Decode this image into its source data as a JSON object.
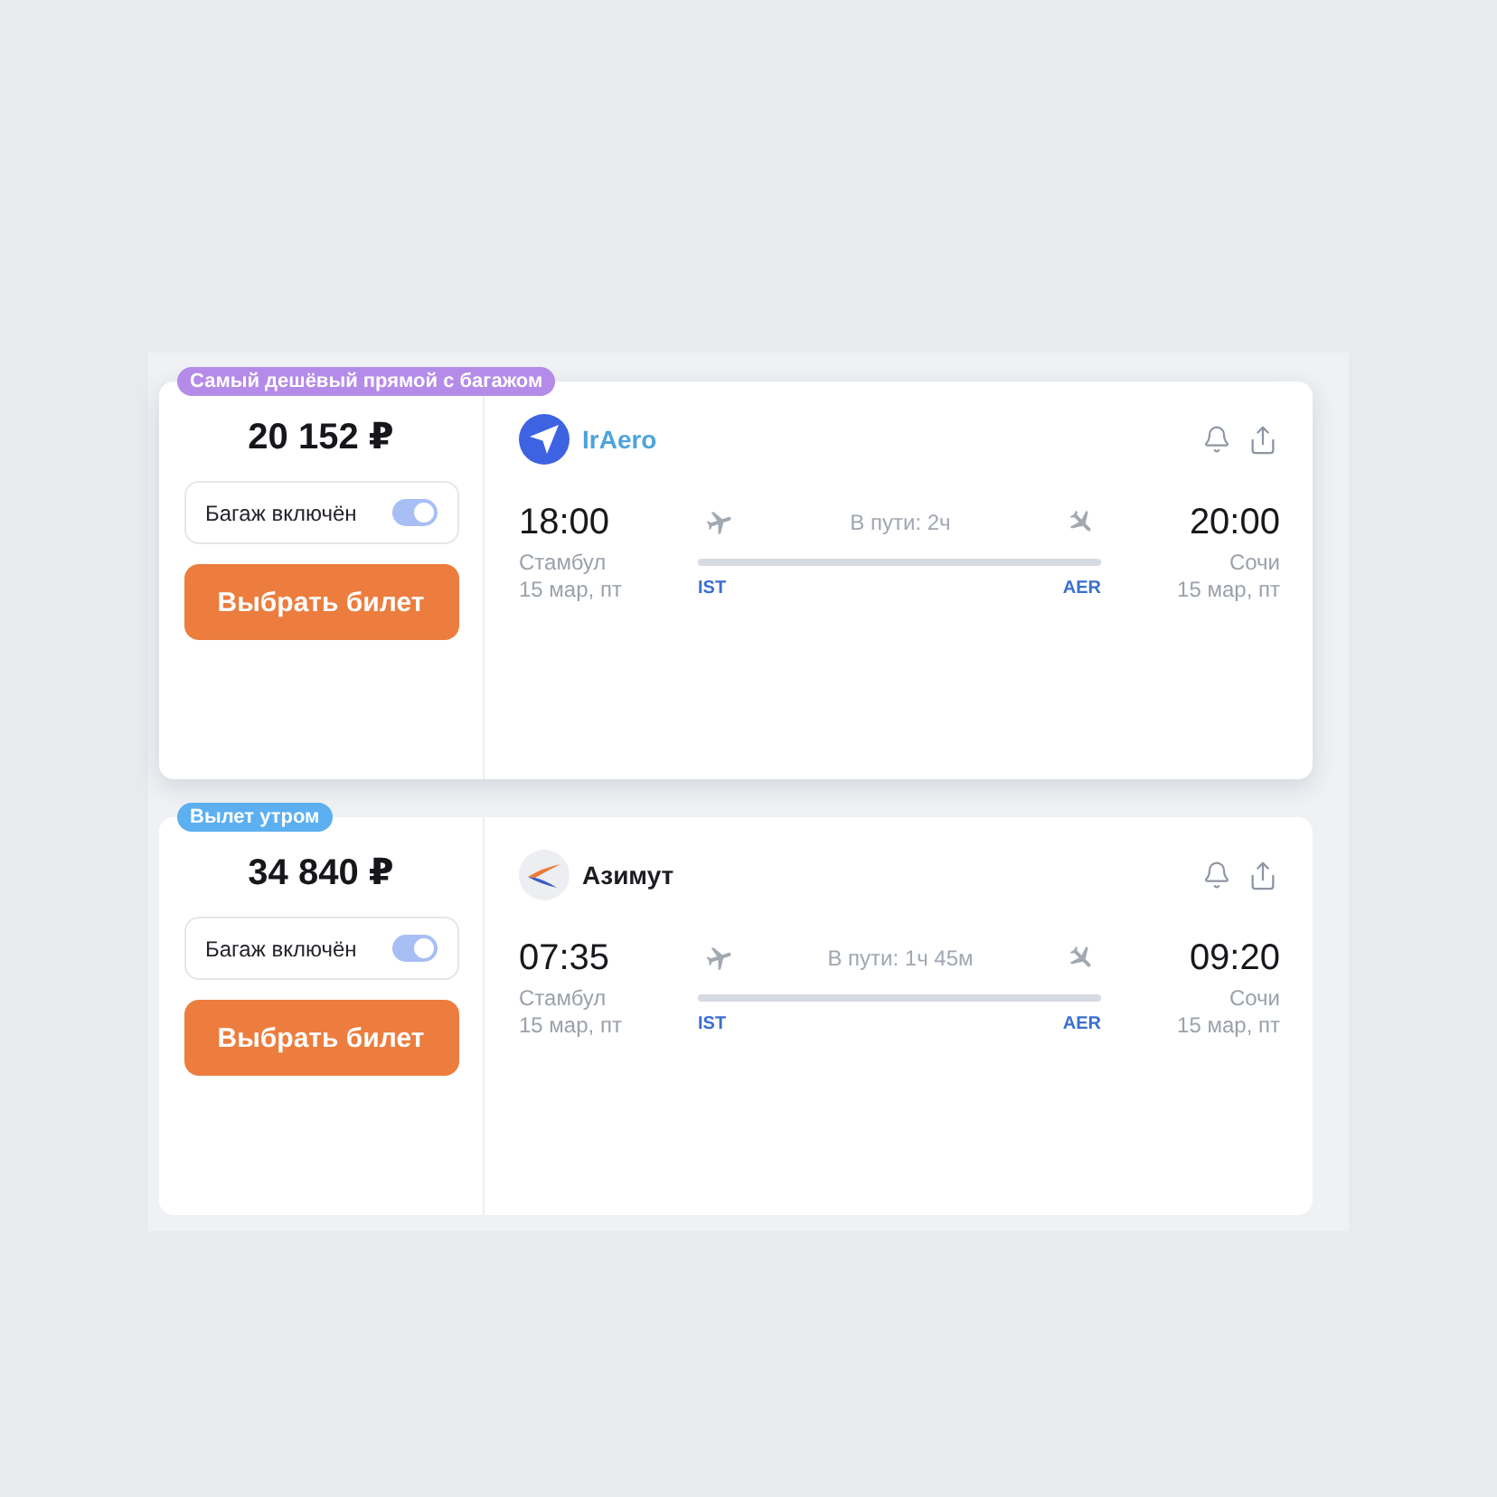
{
  "flights": [
    {
      "raised": true,
      "badge": {
        "text": "Самый дешёвый прямой с багажом",
        "color": "#b48be8"
      },
      "price": "20 152 ₽",
      "baggage": {
        "label": "Багаж включён",
        "on": true
      },
      "button": "Выбрать билет",
      "airline": {
        "name": "IrAero",
        "color": "#4ea3dc",
        "kind": "plane"
      },
      "departure": {
        "time": "18:00",
        "city": "Стамбул",
        "date": "15 мар, пт",
        "code": "IST"
      },
      "duration": "В пути: 2ч",
      "arrival": {
        "time": "20:00",
        "city": "Сочи",
        "date": "15 мар, пт",
        "code": "AER"
      }
    },
    {
      "raised": false,
      "badge": {
        "text": "Вылет утром",
        "color": "#5caff0"
      },
      "price": "34 840 ₽",
      "baggage": {
        "label": "Багаж включён",
        "on": true
      },
      "button": "Выбрать билет",
      "airline": {
        "name": "Азимут",
        "color": "#1b1d22",
        "kind": "swoosh"
      },
      "departure": {
        "time": "07:35",
        "city": "Стамбул",
        "date": "15 мар, пт",
        "code": "IST"
      },
      "duration": "В пути: 1ч 45м",
      "arrival": {
        "time": "09:20",
        "city": "Сочи",
        "date": "15 мар, пт",
        "code": "AER"
      }
    }
  ]
}
